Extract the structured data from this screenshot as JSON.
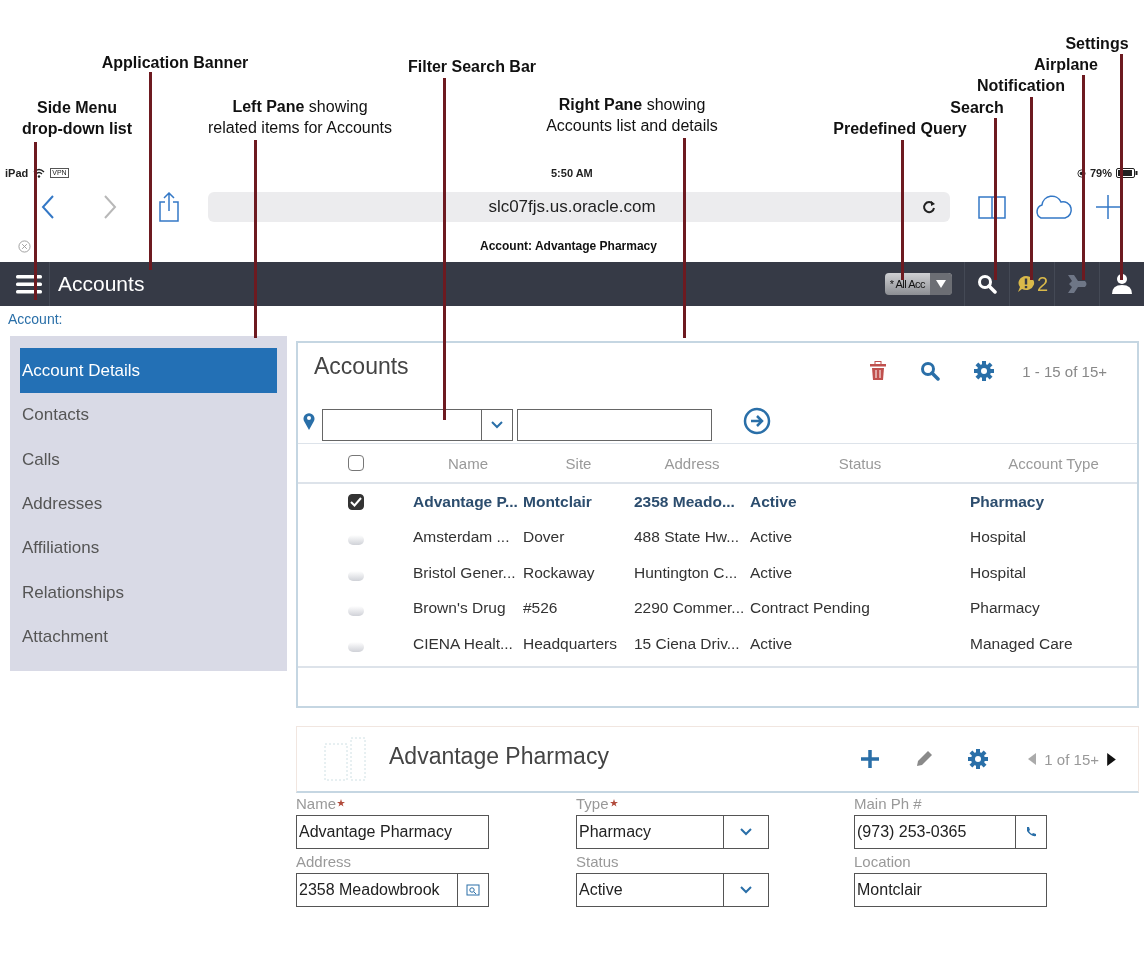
{
  "annotations": [
    {
      "title": "Settings"
    },
    {
      "title": "Application Banner"
    },
    {
      "title": "Filter Search Bar"
    },
    {
      "title": "Airplane"
    },
    {
      "title": "Notification"
    },
    {
      "title": "Side Menu drop-down list"
    },
    {
      "title": "Left Pane",
      "note": "showing related items for Accounts"
    },
    {
      "title": "Right Pane",
      "note": "showing Accounts list and details"
    },
    {
      "title": "Search"
    },
    {
      "title": "Predefined Query"
    }
  ],
  "status_bar": {
    "device": "iPad",
    "vpn": "VPN",
    "time": "5:50 AM",
    "battery": "79%"
  },
  "browser": {
    "url": "slc07fjs.us.oracle.com",
    "page_title": "Account: Advantage Pharmacy"
  },
  "banner": {
    "title": "Accounts",
    "query": "* All Acc",
    "notification_count": "2"
  },
  "breadcrumb": "Account:",
  "left_pane": {
    "items": [
      {
        "label": "Account Details",
        "selected": true
      },
      {
        "label": "Contacts",
        "selected": false
      },
      {
        "label": "Calls",
        "selected": false
      },
      {
        "label": "Addresses",
        "selected": false
      },
      {
        "label": "Affiliations",
        "selected": false
      },
      {
        "label": "Relationships",
        "selected": false
      },
      {
        "label": "Attachment",
        "selected": false
      }
    ]
  },
  "accounts_list": {
    "title": "Accounts",
    "range": "1 - 15 of 15+",
    "select_all_checked": false,
    "columns": [
      "Name",
      "Site",
      "Address",
      "Status",
      "Account Type"
    ],
    "rows": [
      {
        "checked": true,
        "cells": [
          "Advantage P...",
          "Montclair",
          "2358 Meado...",
          "Active",
          "Pharmacy"
        ]
      },
      {
        "checked": false,
        "cells": [
          "Amsterdam ...",
          "Dover",
          "488 State Hw...",
          "Active",
          "Hospital"
        ]
      },
      {
        "checked": false,
        "cells": [
          "Bristol Gener...",
          "Rockaway",
          "Huntington C...",
          "Active",
          "Hospital"
        ]
      },
      {
        "checked": false,
        "cells": [
          "Brown's Drug",
          "#526",
          "2290 Commer...",
          "Contract Pending",
          "Pharmacy"
        ]
      },
      {
        "checked": false,
        "cells": [
          "CIENA Healt...",
          "Headquarters",
          "15 Ciena Driv...",
          "Active",
          "Managed Care"
        ]
      }
    ]
  },
  "details": {
    "title": "Advantage Pharmacy",
    "pager": "1 of 15+",
    "fields": [
      {
        "label": "Name",
        "required": true,
        "kind": "text",
        "value": "Advantage Pharmacy"
      },
      {
        "label": "Type",
        "required": true,
        "kind": "select",
        "value": "Pharmacy"
      },
      {
        "label": "Main Ph #",
        "required": false,
        "kind": "phone",
        "value": "(973) 253-0365"
      },
      {
        "label": "Address",
        "required": false,
        "kind": "address",
        "value": "2358 Meadowbrook"
      },
      {
        "label": "Status",
        "required": false,
        "kind": "select",
        "value": "Active"
      },
      {
        "label": "Location",
        "required": false,
        "kind": "text",
        "value": "Montclair"
      }
    ]
  }
}
